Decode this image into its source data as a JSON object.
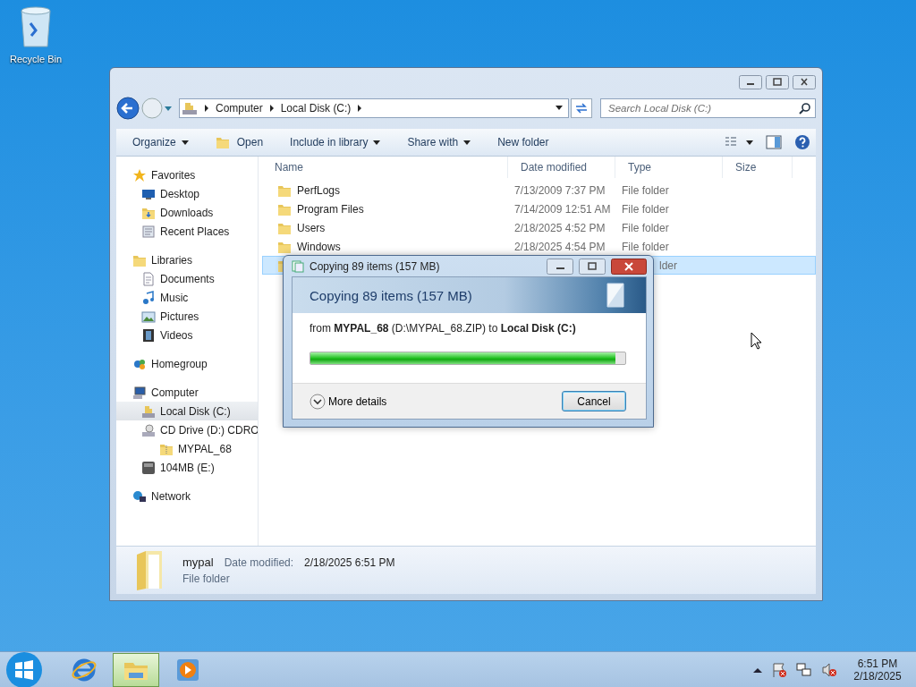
{
  "desktop_icons": [
    {
      "label": "Recycle Bin"
    }
  ],
  "window": {
    "breadcrumb": [
      "Computer",
      "Local Disk (C:)"
    ],
    "search": {
      "placeholder": "Search Local Disk (C:)"
    },
    "toolbar": [
      {
        "label": "Organize",
        "dropdown": true,
        "kind": "text"
      },
      {
        "label": "Open",
        "dropdown": false,
        "kind": "open"
      },
      {
        "label": "Include in library",
        "dropdown": true,
        "kind": "text"
      },
      {
        "label": "Share with",
        "dropdown": true,
        "kind": "text"
      },
      {
        "label": "New folder",
        "dropdown": false,
        "kind": "text"
      }
    ],
    "nav": [
      {
        "label": "Favorites",
        "kind": "star",
        "selected": false,
        "children": [
          {
            "label": "Desktop",
            "kind": "desktop",
            "selected": false
          },
          {
            "label": "Downloads",
            "kind": "downloads",
            "selected": false
          },
          {
            "label": "Recent Places",
            "kind": "recent",
            "selected": false
          }
        ]
      },
      {
        "label": "Libraries",
        "kind": "library",
        "selected": false,
        "children": [
          {
            "label": "Documents",
            "kind": "document",
            "selected": false
          },
          {
            "label": "Music",
            "kind": "music",
            "selected": false
          },
          {
            "label": "Pictures",
            "kind": "picture",
            "selected": false
          },
          {
            "label": "Videos",
            "kind": "video",
            "selected": false
          }
        ]
      },
      {
        "label": "Homegroup",
        "kind": "homegroup",
        "selected": false
      },
      {
        "label": "Computer",
        "kind": "computer",
        "selected": false,
        "children": [
          {
            "label": "Local Disk (C:)",
            "kind": "disk",
            "selected": true
          },
          {
            "label": "CD Drive (D:) CDRO",
            "kind": "cd",
            "selected": false,
            "children": [
              {
                "label": "MYPAL_68",
                "kind": "zip",
                "selected": false
              }
            ]
          },
          {
            "label": "104MB (E:)",
            "kind": "removable",
            "selected": false
          }
        ]
      },
      {
        "label": "Network",
        "kind": "network",
        "selected": false
      }
    ],
    "columns": [
      "Name",
      "Date modified",
      "Type",
      "Size"
    ],
    "rows": [
      {
        "name": "PerfLogs",
        "date": "7/13/2009 7:37 PM",
        "type": "File folder",
        "selected": false
      },
      {
        "name": "Program Files",
        "date": "7/14/2009 12:51 AM",
        "type": "File folder",
        "selected": false
      },
      {
        "name": "Users",
        "date": "2/18/2025 4:52 PM",
        "type": "File folder",
        "selected": false
      },
      {
        "name": "Windows",
        "date": "2/18/2025 4:54 PM",
        "type": "File folder",
        "selected": false
      },
      {
        "type": "lder",
        "selected": true
      }
    ],
    "details": {
      "name": "mypal",
      "label": "Date modified:",
      "value": "2/18/2025 6:51 PM",
      "type": "File folder"
    }
  },
  "dialog": {
    "title": "Copying 89 items (157 MB)",
    "heading": "Copying 89 items (157 MB)",
    "from": "from **MYPAL_68** (D:\\MYPAL_68.ZIP) to **Local Disk (C:)**",
    "level": 0.97,
    "more": "More details",
    "cancel": "Cancel"
  },
  "taskbar": {
    "apps": [
      {
        "kind": "ie",
        "selected": false
      },
      {
        "kind": "explorer",
        "selected": true
      },
      {
        "kind": "media",
        "selected": false
      }
    ],
    "time": "6:51 PM",
    "date": "2/18/2025"
  }
}
